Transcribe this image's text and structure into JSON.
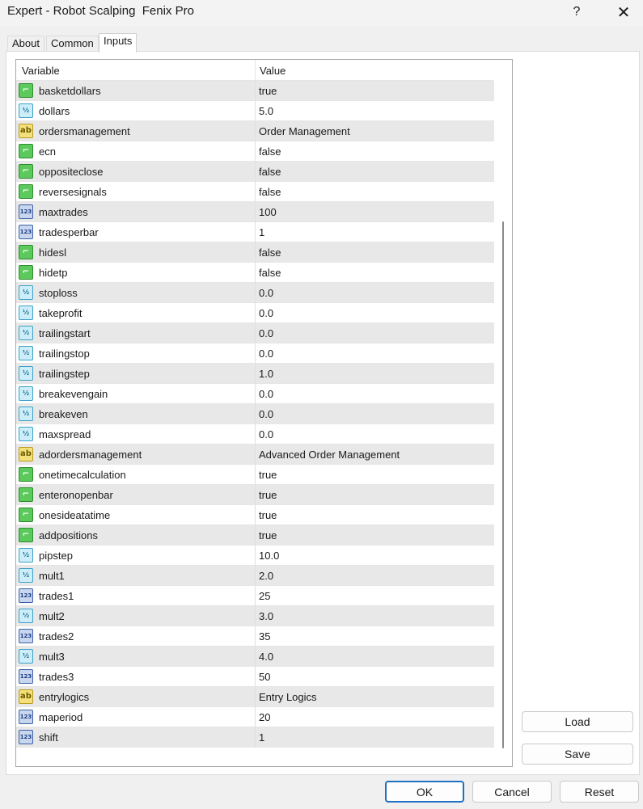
{
  "window": {
    "title": "Expert - Robot Scalping  Fenix Pro",
    "help_glyph": "?",
    "close_glyph": "✕"
  },
  "tabs": [
    "About",
    "Common",
    "Inputs"
  ],
  "grid": {
    "columns": [
      "Variable",
      "Value"
    ],
    "rows": [
      {
        "type": "bool",
        "variable": "basketdollars",
        "value": "true"
      },
      {
        "type": "double",
        "variable": "dollars",
        "value": "5.0"
      },
      {
        "type": "string",
        "variable": "ordersmanagement",
        "value": "Order Management"
      },
      {
        "type": "bool",
        "variable": "ecn",
        "value": "false"
      },
      {
        "type": "bool",
        "variable": "oppositeclose",
        "value": "false"
      },
      {
        "type": "bool",
        "variable": "reversesignals",
        "value": "false"
      },
      {
        "type": "int",
        "variable": "maxtrades",
        "value": "100"
      },
      {
        "type": "int",
        "variable": "tradesperbar",
        "value": "1"
      },
      {
        "type": "bool",
        "variable": "hidesl",
        "value": "false"
      },
      {
        "type": "bool",
        "variable": "hidetp",
        "value": "false"
      },
      {
        "type": "double",
        "variable": "stoploss",
        "value": "0.0"
      },
      {
        "type": "double",
        "variable": "takeprofit",
        "value": "0.0"
      },
      {
        "type": "double",
        "variable": "trailingstart",
        "value": "0.0"
      },
      {
        "type": "double",
        "variable": "trailingstop",
        "value": "0.0"
      },
      {
        "type": "double",
        "variable": "trailingstep",
        "value": "1.0"
      },
      {
        "type": "double",
        "variable": "breakevengain",
        "value": "0.0"
      },
      {
        "type": "double",
        "variable": "breakeven",
        "value": "0.0"
      },
      {
        "type": "double",
        "variable": "maxspread",
        "value": "0.0"
      },
      {
        "type": "string",
        "variable": "adordersmanagement",
        "value": "Advanced Order Management"
      },
      {
        "type": "bool",
        "variable": "onetimecalculation",
        "value": "true"
      },
      {
        "type": "bool",
        "variable": "enteronopenbar",
        "value": "true"
      },
      {
        "type": "bool",
        "variable": "onesideatatime",
        "value": "true"
      },
      {
        "type": "bool",
        "variable": "addpositions",
        "value": "true"
      },
      {
        "type": "double",
        "variable": "pipstep",
        "value": "10.0"
      },
      {
        "type": "double",
        "variable": "mult1",
        "value": "2.0"
      },
      {
        "type": "int",
        "variable": "trades1",
        "value": "25"
      },
      {
        "type": "double",
        "variable": "mult2",
        "value": "3.0"
      },
      {
        "type": "int",
        "variable": "trades2",
        "value": "35"
      },
      {
        "type": "double",
        "variable": "mult3",
        "value": "4.0"
      },
      {
        "type": "int",
        "variable": "trades3",
        "value": "50"
      },
      {
        "type": "string",
        "variable": "entrylogics",
        "value": "Entry Logics"
      },
      {
        "type": "int",
        "variable": "maperiod",
        "value": "20"
      },
      {
        "type": "int",
        "variable": "shift",
        "value": "1"
      }
    ]
  },
  "icons": {
    "bool": {
      "name": "bool-icon",
      "glyph": "⌐",
      "color": "#5cc95c"
    },
    "double": {
      "name": "double-icon",
      "glyph": "½",
      "color": "#cdeef8"
    },
    "int": {
      "name": "int-icon",
      "glyph": "123",
      "color": "#c8d6ee"
    },
    "string": {
      "name": "string-icon",
      "glyph": "ab",
      "color": "#f4e07a"
    }
  },
  "buttons": {
    "load": "Load",
    "save": "Save",
    "ok": "OK",
    "cancel": "Cancel",
    "reset": "Reset"
  },
  "colors": {
    "accent": "#1f6fc5"
  }
}
